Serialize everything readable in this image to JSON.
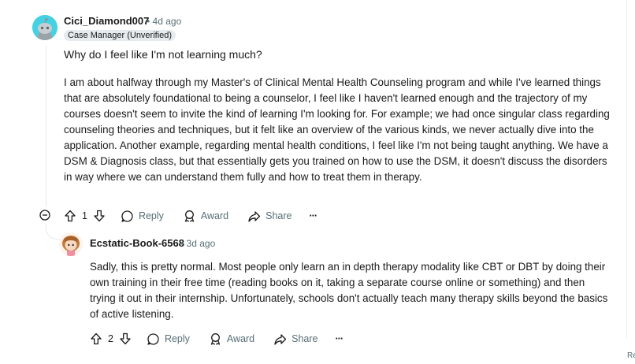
{
  "comment": {
    "username": "Cici_Diamond007",
    "time": "4d ago",
    "flair": "Case Manager (Unverified)",
    "title": "Why do I feel like I'm not learning much?",
    "body": "I am about halfway through my Master's of Clinical Mental Health Counseling program and while I've learned things that are absolutely foundational to being a counselor, I feel like I haven't learned enough and the trajectory of my courses doesn't seem to invite the kind of learning I'm looking for. For example; we had once singular class regarding counseling theories and techniques, but it felt like an overview of the various kinds, we never actually dive into the application. Another example, regarding mental health conditions, I feel like I'm not being taught anything. We have a DSM & Diagnosis class, but that essentially gets you trained on how to use the DSM, it doesn't discuss the disorders in way where we can understand them fully and how to treat them in therapy.",
    "votes": "1",
    "reply_label": "Reply",
    "award_label": "Award",
    "share_label": "Share",
    "more_label": "···"
  },
  "reply": {
    "username": "Ecstatic-Book-6568",
    "time": "3d ago",
    "body": "Sadly, this is pretty normal. Most people only learn an in depth therapy modality like CBT or DBT by doing their own training in their free time (reading books on it, taking a separate course online or something) and then trying it out in their internship. Unfortunately, schools don't actually teach many therapy skills beyond the basics of active listening.",
    "votes": "2",
    "reply_label": "Reply",
    "award_label": "Award",
    "share_label": "Share",
    "more_label": "···"
  },
  "edge_text": "Re",
  "colors": {
    "text": "#1a1a1b",
    "meta": "#576f76",
    "flair_bg": "#e5ebee",
    "avatar_1_bg": "#46d1e3",
    "thread_line": "#e5e9eb"
  },
  "icons": [
    "upvote-icon",
    "downvote-icon",
    "comment-icon",
    "award-icon",
    "share-icon",
    "more-icon",
    "collapse-icon"
  ]
}
